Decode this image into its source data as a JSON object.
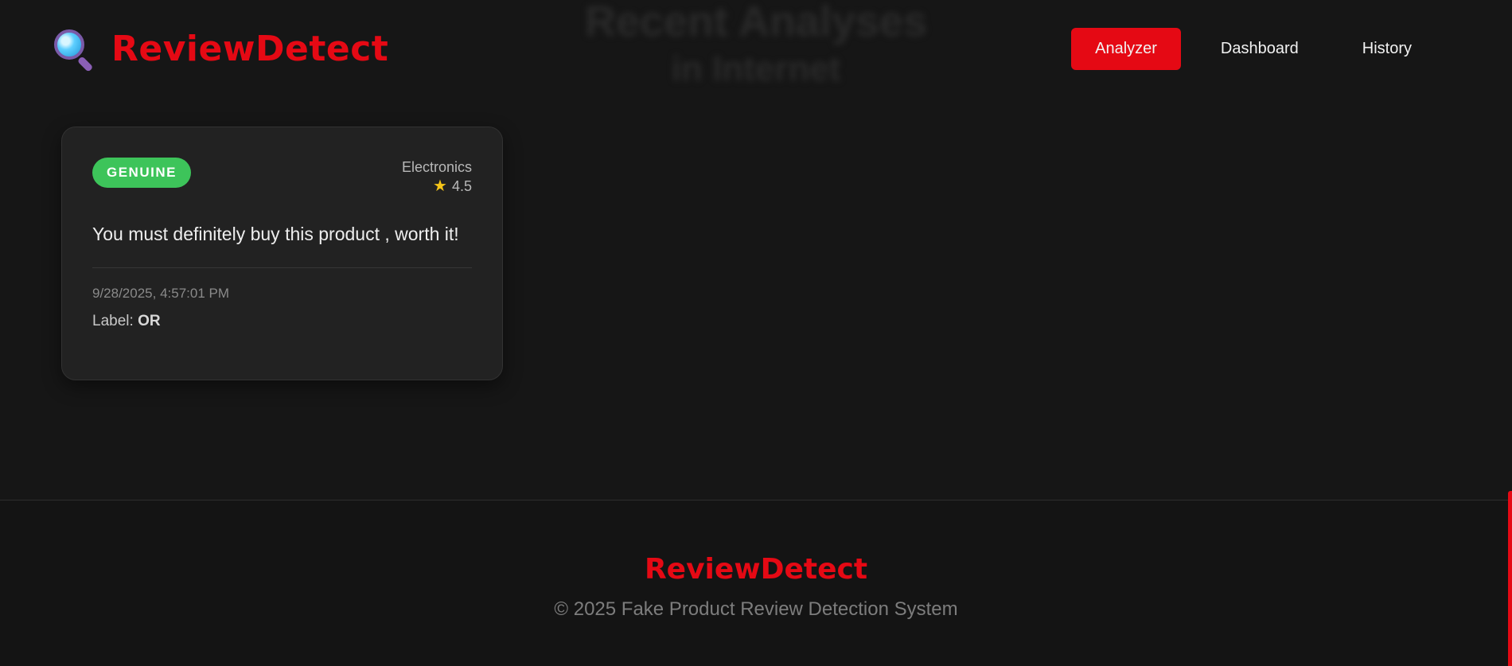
{
  "background_title": {
    "line1": "Recent Analyses",
    "line2": "in Internet"
  },
  "brand": {
    "name": "ReviewDetect",
    "icon": "magnifying-glass-icon",
    "color": "#e50914"
  },
  "nav": {
    "items": [
      {
        "label": "Analyzer",
        "active": true
      },
      {
        "label": "Dashboard",
        "active": false
      },
      {
        "label": "History",
        "active": false
      }
    ]
  },
  "review_card": {
    "status": "GENUINE",
    "status_color": "#3dc45a",
    "category": "Electronics",
    "rating_icon": "star-icon",
    "rating": "4.5",
    "text": "You must definitely buy this product , worth it!",
    "timestamp": "9/28/2025, 4:57:01 PM",
    "label_prefix": "Label:",
    "label_value": "OR"
  },
  "footer": {
    "brand": "ReviewDetect",
    "copyright": "© 2025 Fake Product Review Detection System"
  }
}
